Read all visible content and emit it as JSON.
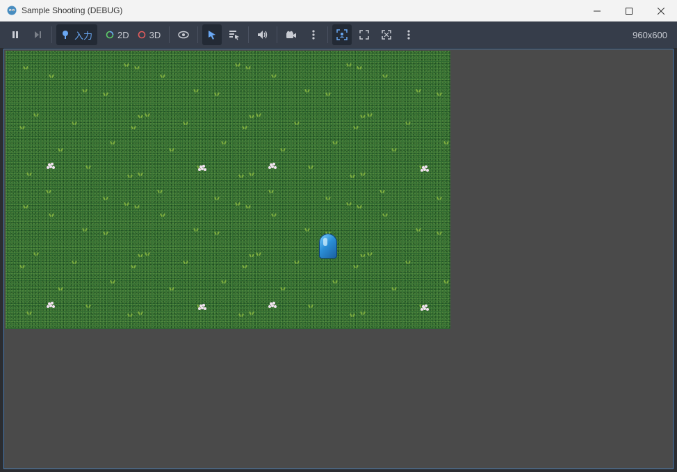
{
  "window": {
    "title": "Sample Shooting (DEBUG)",
    "controls": [
      {
        "name": "minimize-button",
        "icon": "minimize-icon"
      },
      {
        "name": "maximize-button",
        "icon": "maximize-icon"
      },
      {
        "name": "close-button",
        "icon": "close-icon"
      }
    ]
  },
  "toolbar": {
    "pause_icon": "pause-icon",
    "step_icon": "step-forward-icon",
    "input_label": "入力",
    "mode_2d_label": "2D",
    "mode_3d_label": "3D",
    "resolution": "960x600",
    "colors": {
      "background": "#363d4a",
      "active": "#232a35",
      "accent_blue": "#6aa8f4",
      "green_ring": "#5fcf6a",
      "red_ring": "#e45c5c"
    }
  },
  "viewport": {
    "background": "#4a4a4a",
    "game_background": "#2f6a31",
    "player_icon": "player-sprite"
  }
}
